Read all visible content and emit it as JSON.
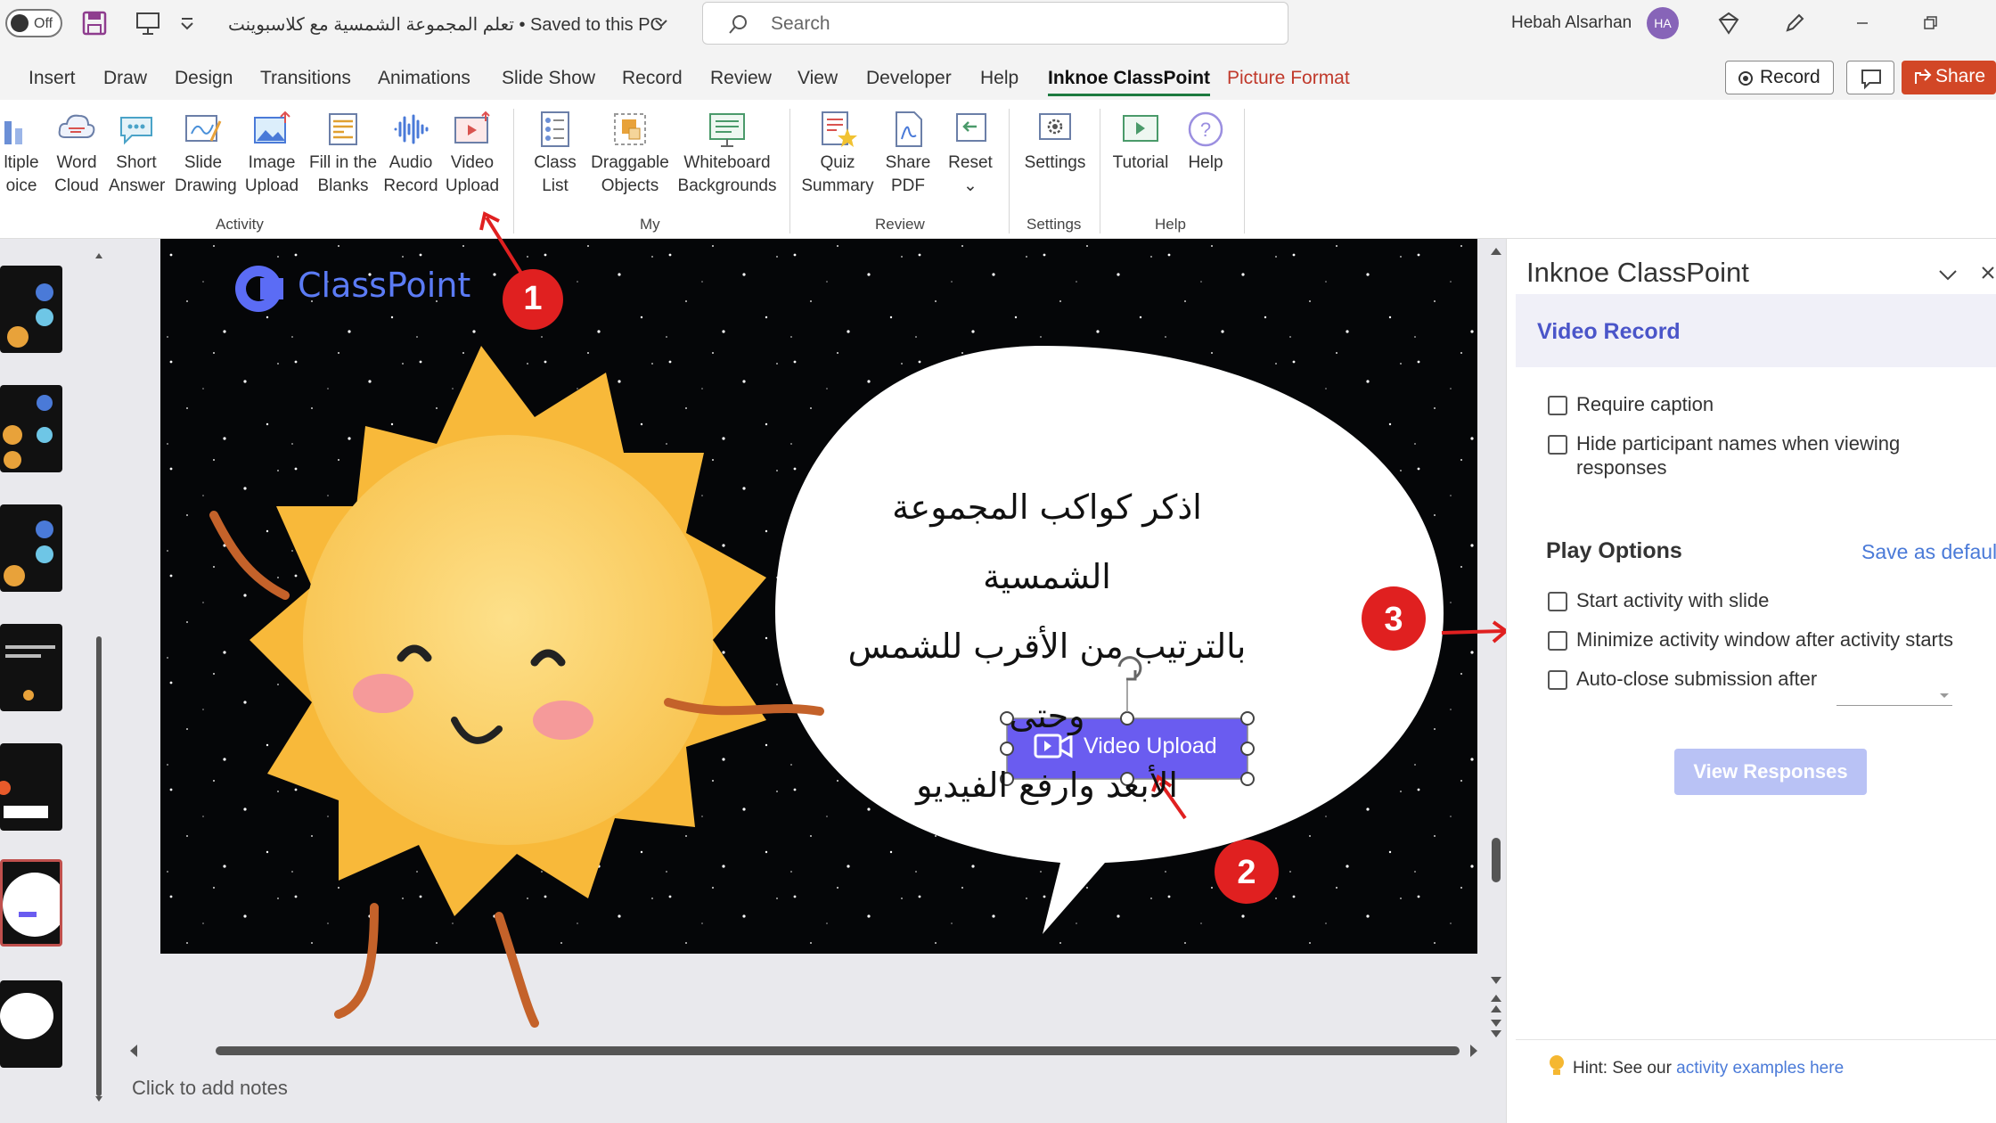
{
  "titlebar": {
    "autosave_state": "Off",
    "doc_title": "تعلم المجموعة الشمسية مع كلاسبوينت • Saved to this PC",
    "search_placeholder": "Search",
    "user_name": "Hebah Alsarhan",
    "user_initials": "HA"
  },
  "tabs": [
    "Insert",
    "Draw",
    "Design",
    "Transitions",
    "Animations",
    "Slide Show",
    "Record",
    "Review",
    "View",
    "Developer",
    "Help",
    "Inknoe ClassPoint",
    "Picture Format"
  ],
  "tabs_right": {
    "record_label": "Record",
    "share_label": "Share"
  },
  "ribbon": {
    "buttons": [
      {
        "label": "ltiple\noice",
        "icon": "multiple-choice-icon"
      },
      {
        "label": "Word\nCloud",
        "icon": "word-cloud-icon"
      },
      {
        "label": "Short\nAnswer",
        "icon": "short-answer-icon"
      },
      {
        "label": "Slide\nDrawing",
        "icon": "slide-drawing-icon"
      },
      {
        "label": "Image\nUpload",
        "icon": "image-upload-icon"
      },
      {
        "label": "Fill in the\nBlanks",
        "icon": "fill-blanks-icon"
      },
      {
        "label": "Audio\nRecord",
        "icon": "audio-record-icon"
      },
      {
        "label": "Video\nUpload",
        "icon": "video-upload-icon"
      },
      {
        "label": "Class\nList",
        "icon": "class-list-icon"
      },
      {
        "label": "Draggable\nObjects",
        "icon": "draggable-objects-icon"
      },
      {
        "label": "Whiteboard\nBackgrounds",
        "icon": "whiteboard-icon"
      },
      {
        "label": "Quiz\nSummary",
        "icon": "quiz-summary-icon"
      },
      {
        "label": "Share\nPDF",
        "icon": "share-pdf-icon"
      },
      {
        "label": "Reset\n⌄",
        "icon": "reset-icon"
      },
      {
        "label": "Settings",
        "icon": "settings-icon"
      },
      {
        "label": "Tutorial",
        "icon": "tutorial-icon"
      },
      {
        "label": "Help",
        "icon": "help-icon"
      }
    ],
    "groups": [
      "Activity",
      "My",
      "Review",
      "Settings",
      "Help"
    ]
  },
  "slide": {
    "brand": "ClassPoint",
    "bubble_lines": [
      "اذكر كواكب المجموعة الشمسية",
      "بالترتيب من الأقرب للشمس وحتى",
      "الأبعد وارفع الفيديو"
    ],
    "button_label": "Video Upload",
    "markers": [
      "1",
      "2",
      "3"
    ]
  },
  "notes_placeholder": "Click to add notes",
  "pane": {
    "title": "Inknoe ClassPoint",
    "section": "Video Record",
    "options": [
      {
        "label": "Require caption",
        "checked": false
      },
      {
        "label": "Hide participant names when viewing\nresponses",
        "checked": false
      }
    ],
    "play_options_title": "Play Options",
    "save_default": "Save as default",
    "play_options": [
      {
        "label": "Start activity with slide",
        "checked": false
      },
      {
        "label": "Minimize activity window after activity starts",
        "checked": false
      },
      {
        "label": "Auto-close submission after",
        "checked": false
      }
    ],
    "view_responses": "View Responses",
    "hint_prefix": "Hint: See our ",
    "hint_link": "activity examples here"
  },
  "colors": {
    "accent_green": "#1c7a3f",
    "share_red": "#d24726",
    "classpoint_purple": "#5b5bf0",
    "annotation_red": "#e02020"
  }
}
